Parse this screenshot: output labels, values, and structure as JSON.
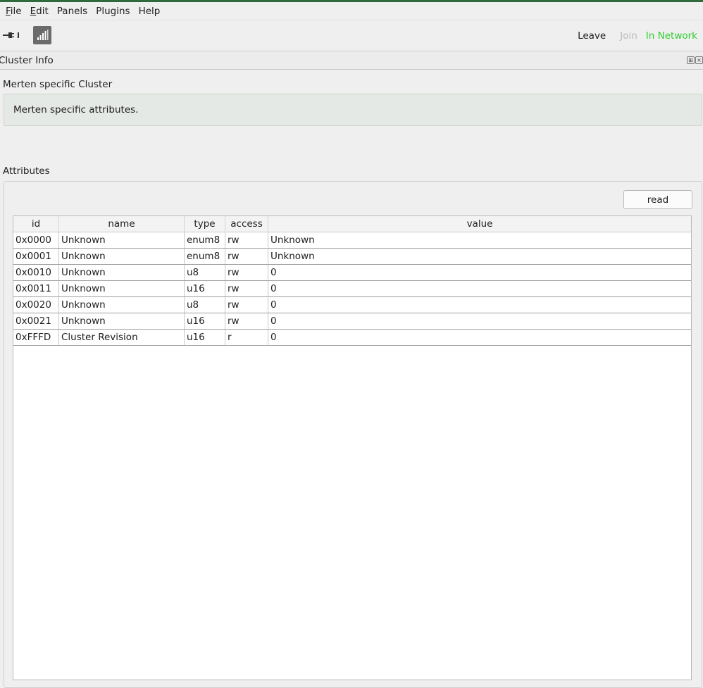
{
  "menubar": {
    "items": [
      {
        "underline": "F",
        "rest": "ile"
      },
      {
        "underline": "E",
        "rest": "dit"
      },
      {
        "underline": "",
        "rest": "Panels"
      },
      {
        "underline": "",
        "rest": "Plugins"
      },
      {
        "underline": "",
        "rest": "Help"
      }
    ]
  },
  "toolbar": {
    "leave_label": "Leave",
    "join_label": "Join",
    "status_label": "In Network",
    "icons": [
      "plug-icon",
      "signal-icon"
    ]
  },
  "dock": {
    "title": "Cluster Info"
  },
  "cluster": {
    "name": "Merten specific Cluster",
    "description": "Merten specific attributes."
  },
  "attributes": {
    "label": "Attributes",
    "read_button": "read",
    "columns": [
      "id",
      "name",
      "type",
      "access",
      "value"
    ],
    "rows": [
      {
        "id": "0x0000",
        "name": "Unknown",
        "type": "enum8",
        "access": "rw",
        "value": "Unknown"
      },
      {
        "id": "0x0001",
        "name": "Unknown",
        "type": "enum8",
        "access": "rw",
        "value": "Unknown"
      },
      {
        "id": "0x0010",
        "name": "Unknown",
        "type": "u8",
        "access": "rw",
        "value": "0"
      },
      {
        "id": "0x0011",
        "name": "Unknown",
        "type": "u16",
        "access": "rw",
        "value": "0"
      },
      {
        "id": "0x0020",
        "name": "Unknown",
        "type": "u8",
        "access": "rw",
        "value": "0"
      },
      {
        "id": "0x0021",
        "name": "Unknown",
        "type": "u16",
        "access": "rw",
        "value": "0"
      },
      {
        "id": "0xFFFD",
        "name": "Cluster Revision",
        "type": "u16",
        "access": "r",
        "value": "0"
      }
    ]
  },
  "colors": {
    "status_green": "#2fce2f",
    "disabled_gray": "#b9b9b9",
    "description_bg": "#e5e9e5"
  }
}
